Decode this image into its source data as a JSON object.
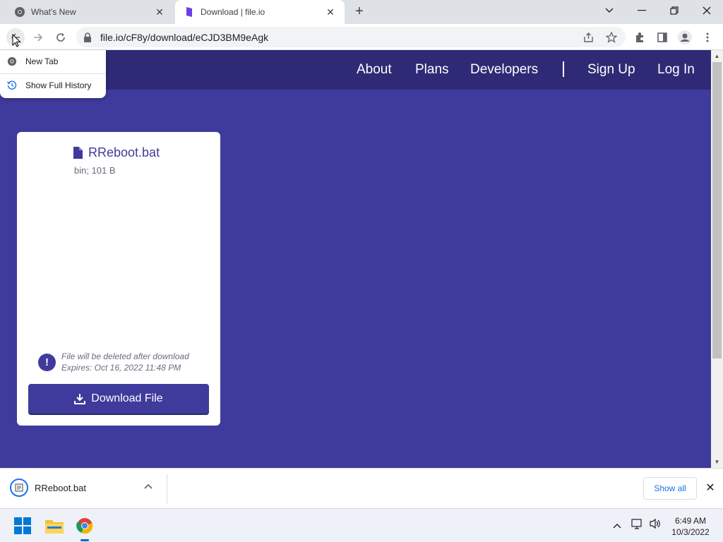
{
  "browser": {
    "tabs": [
      {
        "title": "What's New",
        "active": false
      },
      {
        "title": "Download | file.io",
        "active": true
      }
    ],
    "url": "file.io/cF8y/download/eCJD3BM9eAgk"
  },
  "history_menu": {
    "items": [
      {
        "label": "New Tab"
      },
      {
        "label": "Show Full History"
      }
    ]
  },
  "site": {
    "nav": {
      "about": "About",
      "plans": "Plans",
      "developers": "Developers",
      "sign_up": "Sign Up",
      "log_in": "Log In"
    },
    "file": {
      "name": "RReboot.bat",
      "meta": "bin; 101 B",
      "notice_line1": "File will be deleted after download",
      "notice_line2": "Expires: Oct 16, 2022 11:48 PM",
      "download_label": "Download File"
    }
  },
  "download_bar": {
    "filename": "RReboot.bat",
    "show_all": "Show all"
  },
  "taskbar": {
    "time": "6:49 AM",
    "date": "10/3/2022"
  },
  "colors": {
    "page_bg": "#3f3b9c",
    "header_bg": "#2e2a76",
    "accent_blue": "#1a73e8"
  }
}
